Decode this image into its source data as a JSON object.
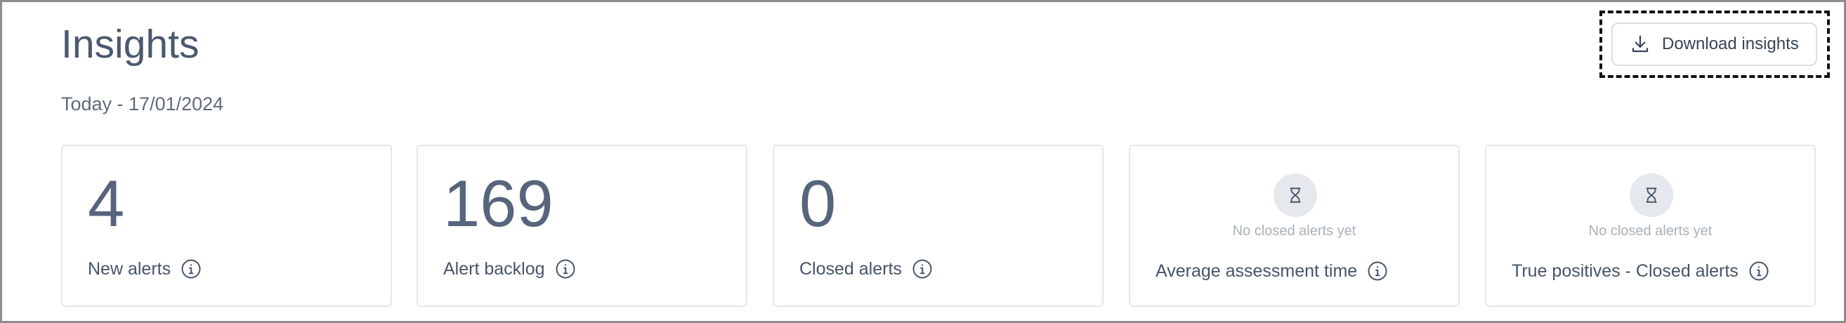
{
  "header": {
    "title": "Insights",
    "date_range": "Today - 17/01/2024",
    "download_button_label": "Download insights"
  },
  "cards": [
    {
      "value": "4",
      "label": "New alerts",
      "info_icon": "info-icon"
    },
    {
      "value": "169",
      "label": "Alert backlog",
      "info_icon": "info-icon"
    },
    {
      "value": "0",
      "label": "Closed alerts",
      "info_icon": "info-icon"
    },
    {
      "empty_text": "No closed alerts yet",
      "label": "Average assessment time",
      "status_icon": "hourglass-icon",
      "info_icon": "info-icon"
    },
    {
      "empty_text": "No closed alerts yet",
      "label": "True positives - Closed alerts",
      "status_icon": "hourglass-icon",
      "info_icon": "info-icon"
    }
  ],
  "colors": {
    "text_primary": "#4b596e",
    "border": "#e3e6eb",
    "highlight_outline": "#111111"
  }
}
